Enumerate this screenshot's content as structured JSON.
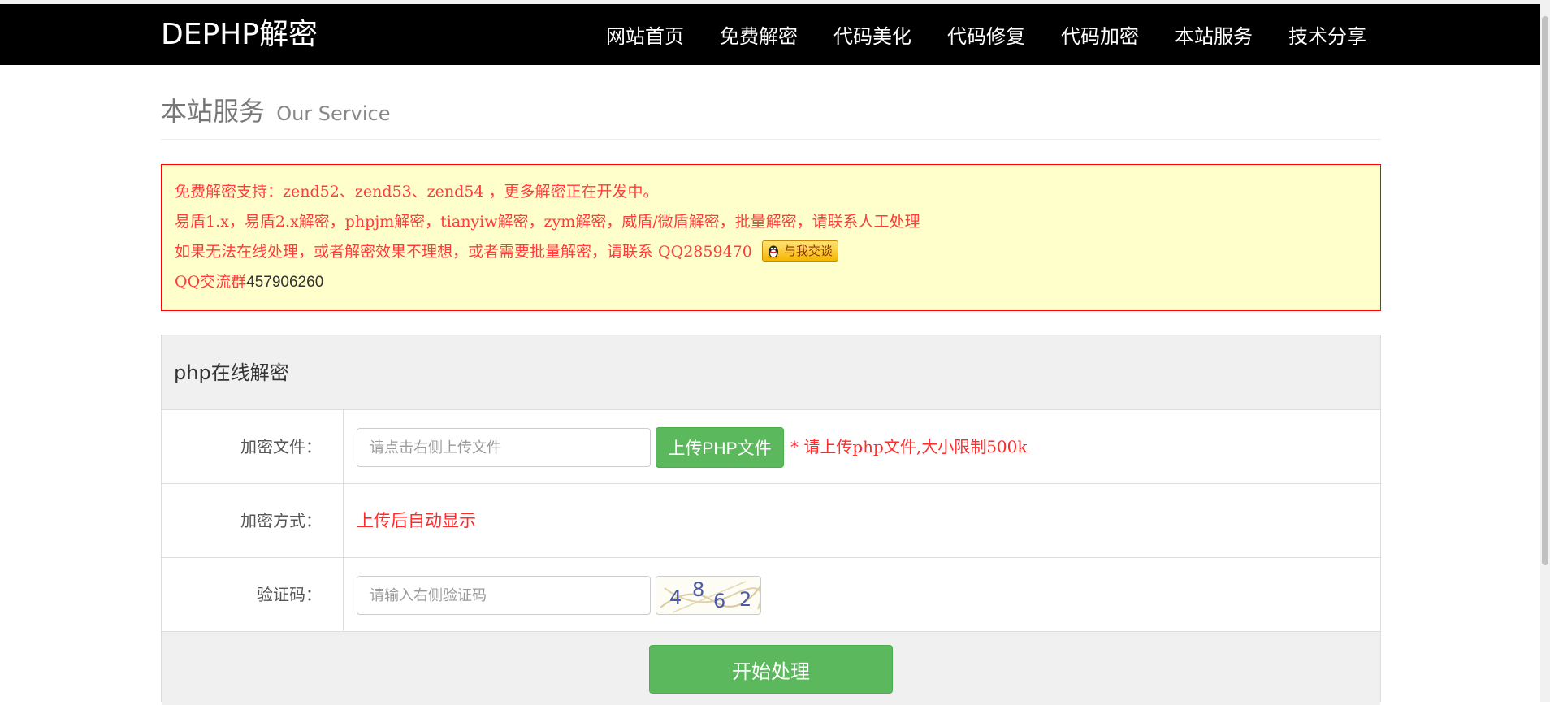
{
  "navbar": {
    "brand": "DEPHP解密",
    "items": [
      "网站首页",
      "免费解密",
      "代码美化",
      "代码修复",
      "代码加密",
      "本站服务",
      "技术分享"
    ]
  },
  "page": {
    "title": "本站服务",
    "subtitle": "Our Service"
  },
  "notice": {
    "line1": "免费解密支持：zend52、zend53、zend54 ，更多解密正在开发中。",
    "line2": "易盾1.x，易盾2.x解密，phpjm解密，tianyiw解密，zym解密，威盾/微盾解密，批量解密，请联系人工处理",
    "line3": "如果无法在线处理，或者解密效果不理想，或者需要批量解密，请联系 QQ2859470",
    "qq_badge": "与我交谈",
    "line4_prefix": "QQ交流群",
    "line4_number": "457906260"
  },
  "form": {
    "panel_title": "php在线解密",
    "file_label": "加密文件：",
    "file_placeholder": "请点击右侧上传文件",
    "upload_button": "上传PHP文件",
    "upload_hint": "* 请上传php文件,大小限制500k",
    "method_label": "加密方式：",
    "method_value": "上传后自动显示",
    "captcha_label": "验证码：",
    "captcha_placeholder": "请输入右侧验证码",
    "captcha_digits": [
      "4",
      "8",
      "6",
      "2"
    ],
    "submit_button": "开始处理"
  },
  "colors": {
    "navbar_bg": "#000000",
    "notice_bg": "#ffffcc",
    "notice_text": "#ff3b3b",
    "button_green": "#5cb85c"
  }
}
